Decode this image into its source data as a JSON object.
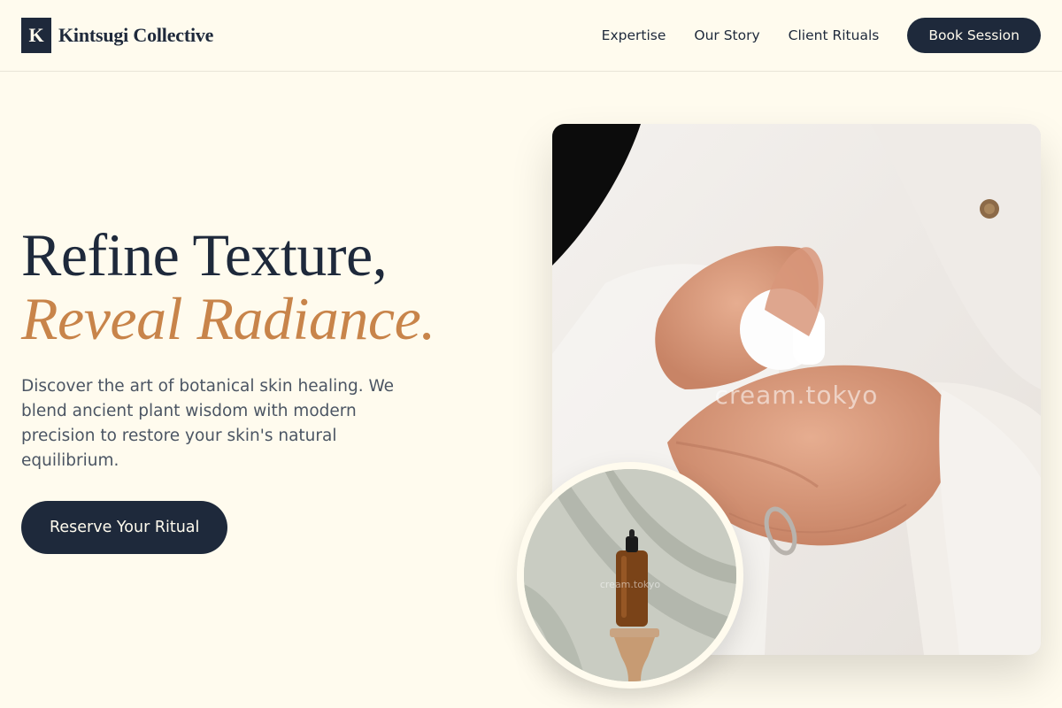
{
  "brand": {
    "mark": "K",
    "name": "Kintsugi Collective"
  },
  "nav": {
    "links": [
      "Expertise",
      "Our Story",
      "Client Rituals"
    ],
    "cta_label": "Book Session"
  },
  "hero": {
    "title_line1": "Refine Texture,",
    "title_line2": "Reveal Radiance.",
    "description": "Discover the art of botanical skin healing. We blend ancient plant wisdom with modern precision to restore your skin's natural equilibrium.",
    "cta_label": "Reserve Your Ritual"
  },
  "images": {
    "main_watermark": "cream.tokyo",
    "circle_watermark": "cream.tokyo"
  },
  "colors": {
    "background": "#fffbee",
    "navy": "#1e293b",
    "accent": "#c8844a",
    "body_text": "#4b5563"
  }
}
